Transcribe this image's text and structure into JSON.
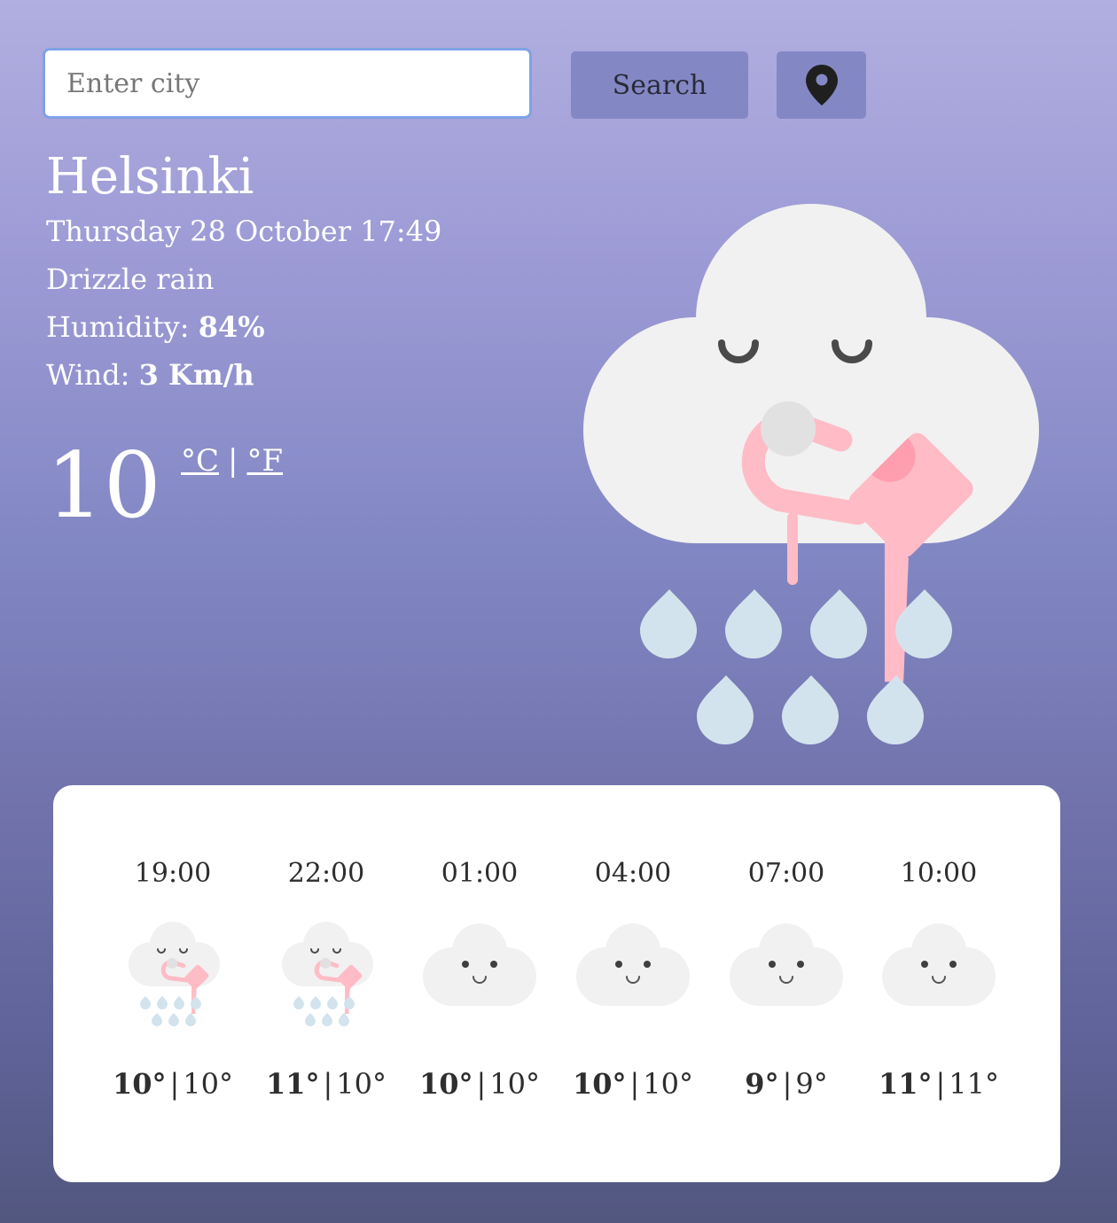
{
  "search": {
    "placeholder": "Enter city",
    "button_label": "Search"
  },
  "location_button": {
    "icon": "map-pin-icon"
  },
  "current": {
    "city": "Helsinki",
    "datetime": "Thursday 28 October 17:49",
    "description": "Drizzle rain",
    "humidity_label": "Humidity:",
    "humidity_value": "84%",
    "wind_label": "Wind:",
    "wind_value": "3 Km/h",
    "temperature": "10",
    "unit_celsius": "°C",
    "unit_fahrenheit": "°F",
    "unit_separator": "|",
    "icon": "rain-cloud-watering-can-icon"
  },
  "forecast": [
    {
      "time": "19:00",
      "max": "10°",
      "min": "10°",
      "icon": "rain"
    },
    {
      "time": "22:00",
      "max": "11°",
      "min": "10°",
      "icon": "rain"
    },
    {
      "time": "01:00",
      "max": "10°",
      "min": "10°",
      "icon": "cloud"
    },
    {
      "time": "04:00",
      "max": "10°",
      "min": "10°",
      "icon": "cloud"
    },
    {
      "time": "07:00",
      "max": "9°",
      "min": "9°",
      "icon": "cloud"
    },
    {
      "time": "10:00",
      "max": "11°",
      "min": "11°",
      "icon": "cloud"
    }
  ],
  "colors": {
    "cloud": "#f1f1f1",
    "can": "#ffbcc6",
    "drop": "#d3e3ed",
    "face": "#4a4a4a"
  }
}
